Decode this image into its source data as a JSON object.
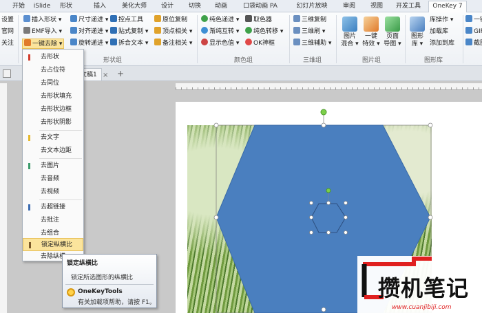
{
  "tabs": [
    {
      "label": "开始"
    },
    {
      "label": "iSlide"
    },
    {
      "label": "形状"
    },
    {
      "label": "插入"
    },
    {
      "label": "美化大师"
    },
    {
      "label": "设计"
    },
    {
      "label": "切换"
    },
    {
      "label": "动画"
    },
    {
      "label": "口袋动画 PA"
    },
    {
      "label": "幻灯片放映"
    },
    {
      "label": "审阅"
    },
    {
      "label": "视图"
    },
    {
      "label": "开发工具"
    },
    {
      "label": "OneKey 7"
    }
  ],
  "ribbon": {
    "left_col": [
      "设置",
      "官网",
      "关注"
    ],
    "col1": [
      "插入形状",
      "EMF导入",
      "一键去除"
    ],
    "col2": [
      "尺寸递进",
      "对齐递进",
      "旋转递进"
    ],
    "col3": [
      "控点工具",
      "贴式复制",
      "拆合文本"
    ],
    "col4": [
      "原位复制",
      "顶点相关",
      "备注相关"
    ],
    "col5": [
      "纯色递进",
      "渐纯互转",
      "显示色值"
    ],
    "col6": [
      "取色器",
      "纯色转移",
      "OK神框"
    ],
    "col7": [
      "三维复制",
      "三维刷",
      "三维辅助"
    ],
    "big_btns": [
      {
        "l1": "图片",
        "l2": "混合"
      },
      {
        "l1": "一键",
        "l2": "特效"
      },
      {
        "l1": "页面",
        "l2": "导图"
      },
      {
        "l1": "图形",
        "l2": "库"
      }
    ],
    "col8": [
      "库操作",
      "加载库",
      "添加到库"
    ],
    "col9": [
      "一键",
      "GIF",
      "截图"
    ],
    "groups": [
      "形状组",
      "颜色组",
      "三维组",
      "图片组",
      "图形库"
    ]
  },
  "doc_tab": "文稿1",
  "menu": {
    "items": [
      "去形状",
      "去占位符",
      "去同位",
      "去形状填充",
      "去形状边框",
      "去形状阴影",
      "去文字",
      "去文本边距",
      "去图片",
      "去音频",
      "去视频",
      "去超链接",
      "去批注",
      "去组合",
      "锁定纵横比",
      "去除纵横"
    ],
    "highlighted": "锁定纵横比"
  },
  "tooltip": {
    "title": "锁定纵横比",
    "desc": "锁定所选图形的纵横比",
    "help_title": "OneKeyTools",
    "help_text": "有关加载项帮助，请按 F1。"
  },
  "watermark": {
    "text": "攒机笔记",
    "url": "www.cuanjibiji.com"
  },
  "colors": {
    "hexagon": "#4a7fbf",
    "menu_highlight": "#fbe49c",
    "watermark_red": "#e02020"
  }
}
